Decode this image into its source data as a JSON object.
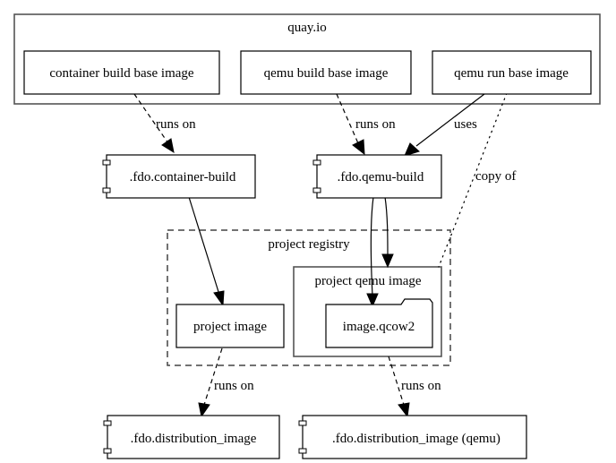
{
  "clusters": {
    "quay": {
      "label": "quay.io"
    },
    "registry": {
      "label": "project registry"
    },
    "qemu_image": {
      "label": "project qemu image"
    }
  },
  "nodes": {
    "container_base": {
      "label": "container build base image",
      "shape": "box"
    },
    "qemu_build_base": {
      "label": "qemu build base image",
      "shape": "box"
    },
    "qemu_run_base": {
      "label": "qemu run base image",
      "shape": "box"
    },
    "fdo_container_build": {
      "label": ".fdo.container-build",
      "shape": "component"
    },
    "fdo_qemu_build": {
      "label": ".fdo.qemu-build",
      "shape": "component"
    },
    "project_image": {
      "label": "project image",
      "shape": "box"
    },
    "image_qcow2": {
      "label": "image.qcow2",
      "shape": "folder"
    },
    "fdo_distribution_image": {
      "label": ".fdo.distribution_image",
      "shape": "component"
    },
    "fdo_distribution_image_qemu": {
      "label": ".fdo.distribution_image (qemu)",
      "shape": "component"
    }
  },
  "edges": [
    {
      "from": "container_base",
      "to": "fdo_container_build",
      "label": "runs on",
      "style": "dashed"
    },
    {
      "from": "qemu_build_base",
      "to": "fdo_qemu_build",
      "label": "runs on",
      "style": "dashed"
    },
    {
      "from": "qemu_run_base",
      "to": "fdo_qemu_build",
      "label": "uses",
      "style": "solid"
    },
    {
      "from": "qemu_run_base",
      "to": "project_qemu_image",
      "label": "copy of",
      "style": "dotted"
    },
    {
      "from": "fdo_container_build",
      "to": "project_image",
      "label": "",
      "style": "solid"
    },
    {
      "from": "fdo_qemu_build",
      "to": "image_qcow2",
      "label": "",
      "style": "solid"
    },
    {
      "from": "fdo_qemu_build",
      "to": "project_qemu_image",
      "label": "",
      "style": "solid"
    },
    {
      "from": "project_image",
      "to": "fdo_distribution_image",
      "label": "runs on",
      "style": "dashed"
    },
    {
      "from": "project_qemu_image",
      "to": "fdo_distribution_image_qemu",
      "label": "runs on",
      "style": "dashed"
    }
  ]
}
